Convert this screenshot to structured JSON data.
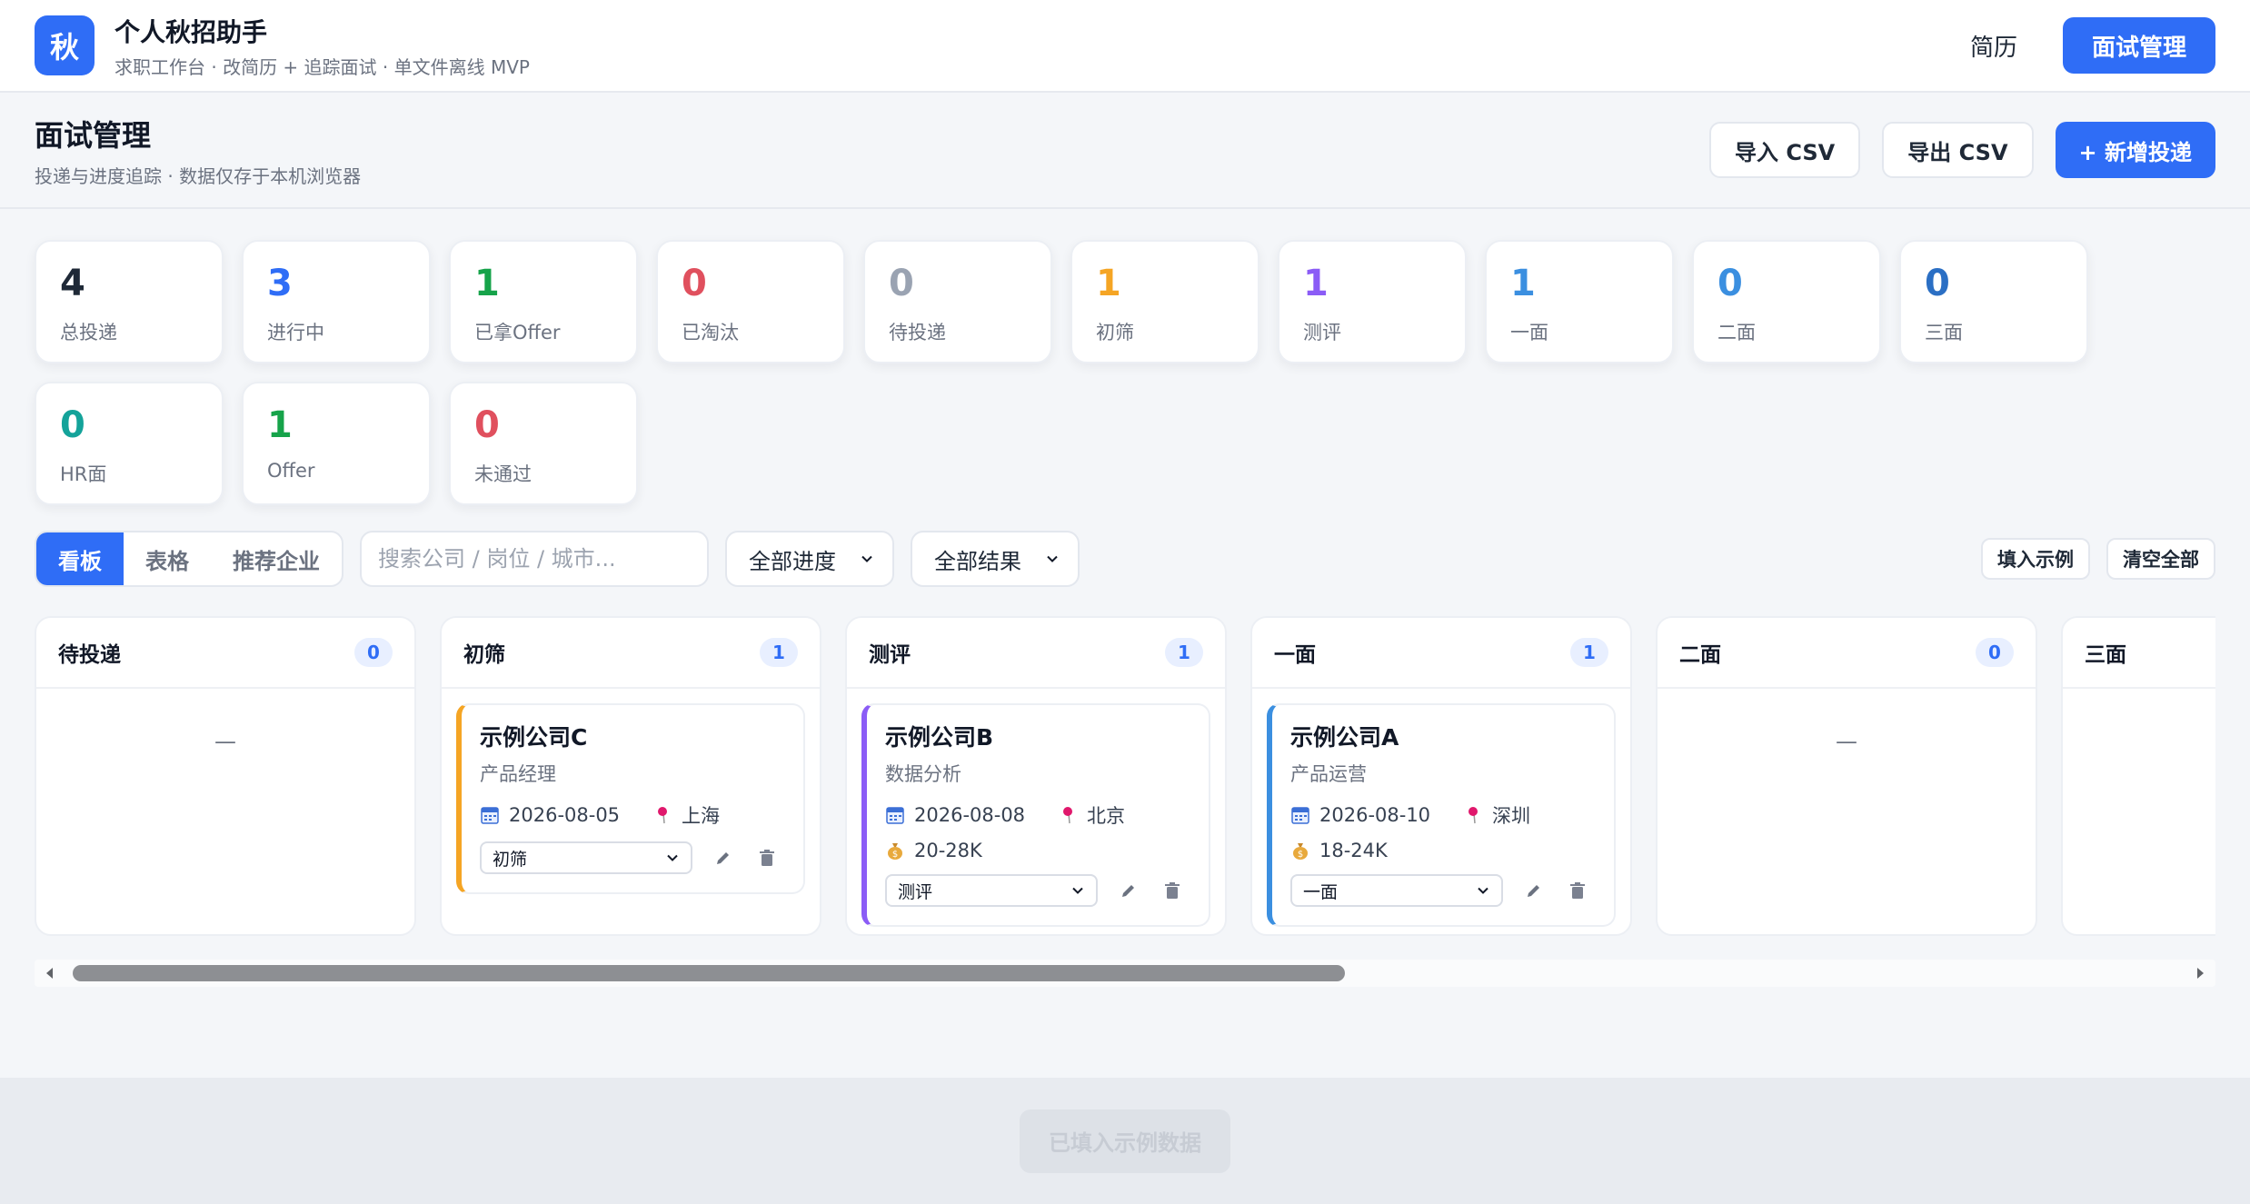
{
  "app": {
    "logo_char": "秋",
    "title": "个人秋招助手",
    "subtitle": "求职工作台 · 改简历 + 追踪面试 · 单文件离线 MVP",
    "nav": {
      "resume": "简历",
      "interviews": "面试管理"
    }
  },
  "page": {
    "title": "面试管理",
    "subtitle": "投递与进度追踪 · 数据仅存于本机浏览器",
    "import_label": "导入 CSV",
    "export_label": "导出 CSV",
    "add_label": "+ 新增投递"
  },
  "stats": [
    {
      "value": "4",
      "label": "总投递",
      "color": "#1f2937"
    },
    {
      "value": "3",
      "label": "进行中",
      "color": "#2f6df6"
    },
    {
      "value": "1",
      "label": "已拿Offer",
      "color": "#16a34a"
    },
    {
      "value": "0",
      "label": "已淘汰",
      "color": "#e0505e"
    },
    {
      "value": "0",
      "label": "待投递",
      "color": "#9aa3b2"
    },
    {
      "value": "1",
      "label": "初筛",
      "color": "#f5a524"
    },
    {
      "value": "1",
      "label": "测评",
      "color": "#8b5cf6"
    },
    {
      "value": "1",
      "label": "一面",
      "color": "#3b8fe0"
    },
    {
      "value": "0",
      "label": "二面",
      "color": "#3b8fe0"
    },
    {
      "value": "0",
      "label": "三面",
      "color": "#2b6fc4"
    },
    {
      "value": "0",
      "label": "HR面",
      "color": "#14a39a"
    },
    {
      "value": "1",
      "label": "Offer",
      "color": "#16a34a"
    },
    {
      "value": "0",
      "label": "未通过",
      "color": "#e0505e"
    }
  ],
  "toolbar": {
    "views": [
      "看板",
      "表格",
      "推荐企业"
    ],
    "search_placeholder": "搜索公司 / 岗位 / 城市...",
    "filter_stage": "全部进度",
    "filter_result": "全部结果",
    "fill_sample": "填入示例",
    "clear_all": "清空全部"
  },
  "board": {
    "empty_mark": "—",
    "columns": [
      {
        "title": "待投递",
        "count": "0"
      },
      {
        "title": "初筛",
        "count": "1"
      },
      {
        "title": "测评",
        "count": "1"
      },
      {
        "title": "一面",
        "count": "1"
      },
      {
        "title": "二面",
        "count": "0"
      },
      {
        "title": "三面",
        "count": ""
      }
    ],
    "cards": {
      "c": {
        "company": "示例公司C",
        "role": "产品经理",
        "date": "2026-08-05",
        "city": "上海",
        "stage": "初筛",
        "accent": "#f5a524"
      },
      "b": {
        "company": "示例公司B",
        "role": "数据分析",
        "date": "2026-08-08",
        "city": "北京",
        "salary": "20-28K",
        "stage": "测评",
        "accent": "#8b5cf6"
      },
      "a": {
        "company": "示例公司A",
        "role": "产品运营",
        "date": "2026-08-10",
        "city": "深圳",
        "salary": "18-24K",
        "stage": "一面",
        "accent": "#3b8fe0"
      }
    }
  },
  "footer": {
    "toast": "已填入示例数据"
  }
}
